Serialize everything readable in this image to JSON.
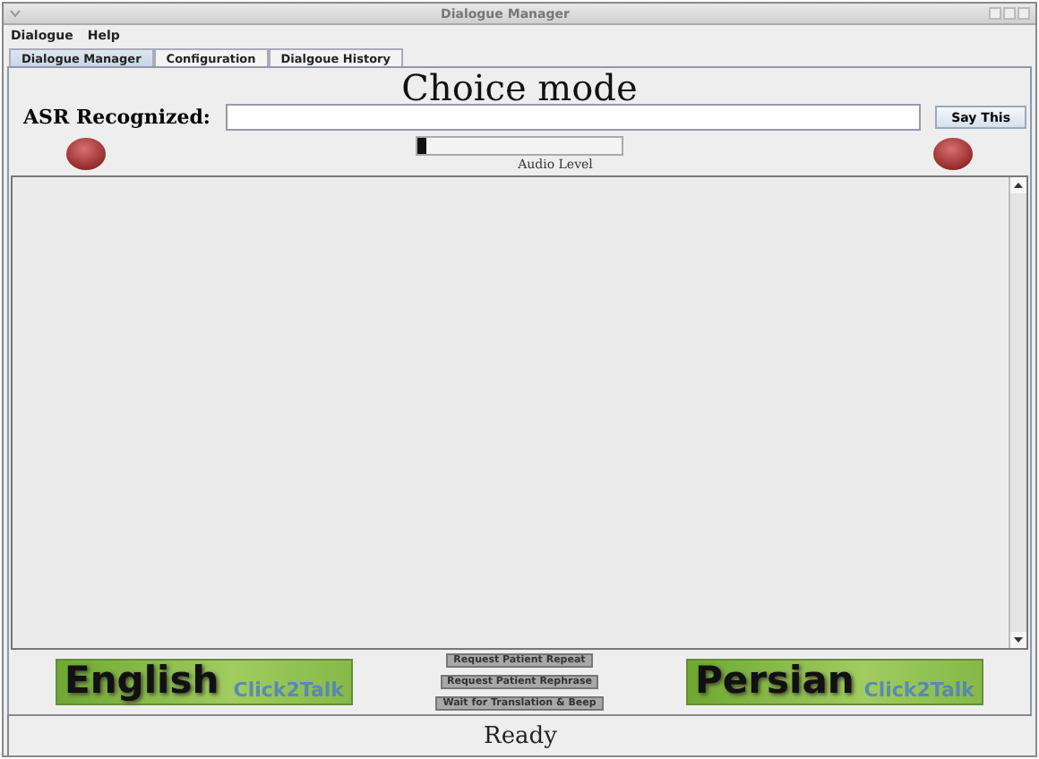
{
  "window": {
    "title": "Dialogue Manager"
  },
  "menu": [
    "Dialogue",
    "Help"
  ],
  "tabs": [
    {
      "label": "Dialogue Manager",
      "selected": true
    },
    {
      "label": "Configuration",
      "selected": false
    },
    {
      "label": "Dialgoue History",
      "selected": false
    }
  ],
  "mode_title": "Choice mode",
  "asr": {
    "label": "ASR Recognized:",
    "button": "Say This"
  },
  "audio": {
    "level": 0.04,
    "label": "Audio Level"
  },
  "languages": [
    {
      "name": "English",
      "logo": "Click2Talk"
    },
    {
      "name": "Persian",
      "logo": "Click2Talk"
    }
  ],
  "actions": [
    "Request Patient Repeat",
    "Request Patient Rephrase",
    "Wait for Translation & Beep"
  ],
  "status": "Ready"
}
